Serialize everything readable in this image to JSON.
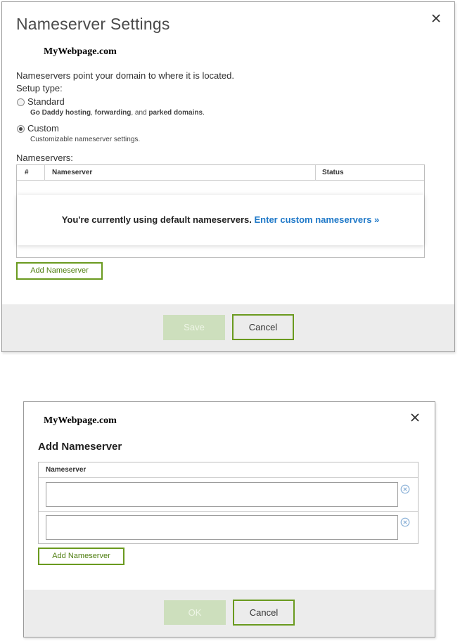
{
  "dialog1": {
    "title": "Nameserver Settings",
    "site_name": "MyWebpage.com",
    "description": "Nameservers point your domain to where it is located.",
    "setup_type_label": "Setup type:",
    "options": [
      {
        "label": "Standard",
        "desc_1": "Go Daddy hosting",
        "desc_sep1": ", ",
        "desc_2": "forwarding",
        "desc_sep2": ", and ",
        "desc_3": "parked domains",
        "desc_end": ".",
        "selected": false
      },
      {
        "label": "Custom",
        "desc": "Customizable nameserver settings.",
        "selected": true
      }
    ],
    "nameservers_label": "Nameservers:",
    "table": {
      "col_num": "#",
      "col_nameserver": "Nameserver",
      "col_status": "Status"
    },
    "notice_text": "You're currently using default nameservers.",
    "notice_link": "Enter custom nameservers »",
    "add_button": "Add Nameserver",
    "save_button": "Save",
    "cancel_button": "Cancel"
  },
  "dialog2": {
    "site_name": "MyWebpage.com",
    "title": "Add Nameserver",
    "table_header": "Nameserver",
    "inputs": [
      {
        "value": "",
        "placeholder": ""
      },
      {
        "value": "",
        "placeholder": ""
      }
    ],
    "add_button": "Add Nameserver",
    "ok_button": "OK",
    "cancel_button": "Cancel"
  },
  "icons": {
    "close": "close-icon",
    "remove": "remove-circle-icon"
  },
  "colors": {
    "accent_green": "#6a9a1f",
    "link_blue": "#1e78c8",
    "disabled_green": "#cddfbd",
    "footer_gray": "#ececec"
  }
}
